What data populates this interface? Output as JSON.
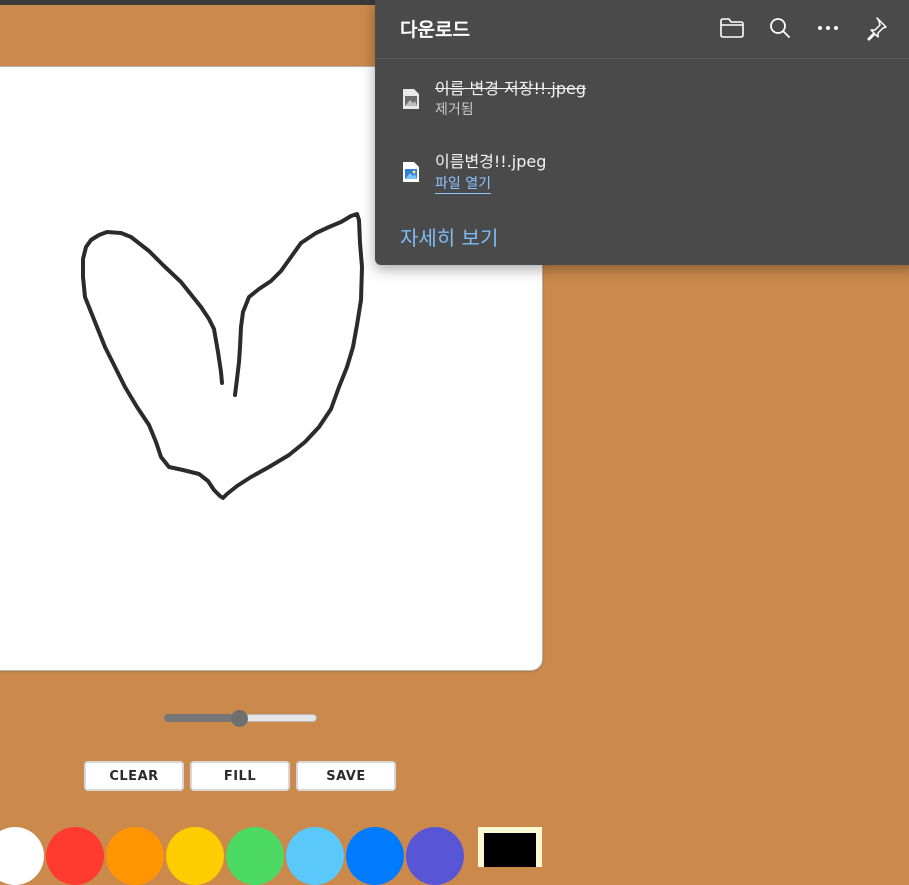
{
  "canvas": {
    "stroke_color": "#2b2b2b",
    "drawing": "heart-sketch"
  },
  "brush_size": {
    "value_fraction": 0.49
  },
  "buttons": {
    "clear": "CLEAR",
    "fill": "FILL",
    "save": "SAVE"
  },
  "palette": {
    "colors": [
      "#ffffff",
      "#ff3b30",
      "#ff9500",
      "#ffcc00",
      "#4cd964",
      "#5ac8fa",
      "#007aff",
      "#5856d6"
    ],
    "current": "#000000"
  },
  "downloads": {
    "title": "다운로드",
    "icons": [
      "folder-icon",
      "search-icon",
      "more-icon",
      "pin-icon"
    ],
    "items": [
      {
        "name": "이름 변경 저장!!.jpeg",
        "status": "제거됨",
        "removed": true
      },
      {
        "name": "이름변경!!.jpeg",
        "status": "파일 열기",
        "removed": false
      }
    ],
    "see_more": "자세히 보기"
  }
}
